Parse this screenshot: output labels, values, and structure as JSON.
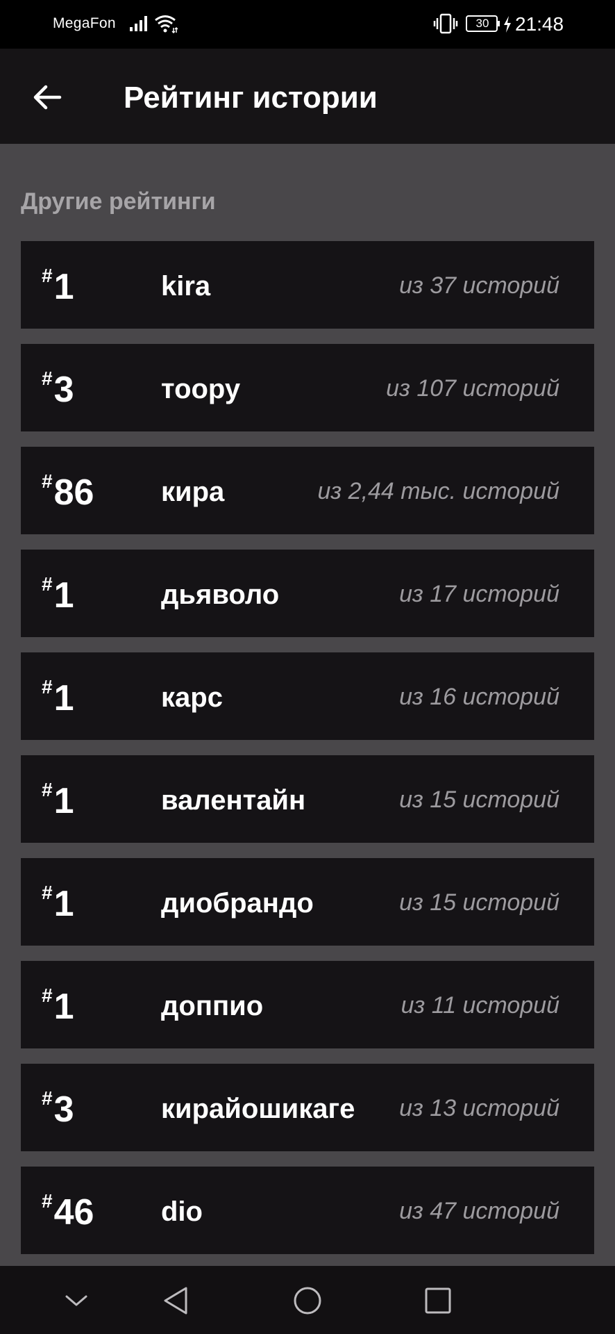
{
  "status_bar": {
    "carrier": "MegaFon",
    "battery": "30",
    "time": "21:48"
  },
  "header": {
    "title": "Рейтинг истории"
  },
  "section": {
    "title": "Другие рейтинги"
  },
  "ratings": [
    {
      "hash": "#",
      "rank": "1",
      "name": "kira",
      "count": "из 37 историй"
    },
    {
      "hash": "#",
      "rank": "3",
      "name": "тоору",
      "count": "из 107 историй"
    },
    {
      "hash": "#",
      "rank": "86",
      "name": "кира",
      "count": "из 2,44 тыс. историй"
    },
    {
      "hash": "#",
      "rank": "1",
      "name": "дьяволо",
      "count": "из 17 историй"
    },
    {
      "hash": "#",
      "rank": "1",
      "name": "карс",
      "count": "из 16 историй"
    },
    {
      "hash": "#",
      "rank": "1",
      "name": "валентайн",
      "count": "из 15 историй"
    },
    {
      "hash": "#",
      "rank": "1",
      "name": "диобрандо",
      "count": "из 15 историй"
    },
    {
      "hash": "#",
      "rank": "1",
      "name": "доппио",
      "count": "из 11 историй"
    },
    {
      "hash": "#",
      "rank": "3",
      "name": "кирайошикаге",
      "count": "из 13 историй"
    },
    {
      "hash": "#",
      "rank": "46",
      "name": "dio",
      "count": "из 47 историй"
    }
  ],
  "icons": {
    "back": "arrow-left-icon",
    "signal": "signal-icon",
    "wifi": "wifi-icon",
    "vibrate": "vibrate-icon",
    "charge": "lightning-icon"
  },
  "colors": {
    "app_bar": "#161416",
    "background": "#49474a",
    "row": "#151316",
    "secondary_text": "#9d9b9f"
  }
}
